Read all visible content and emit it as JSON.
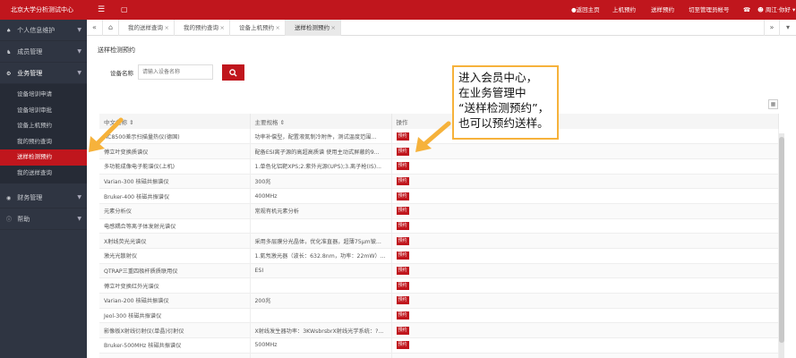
{
  "app": {
    "title": "北京大学分析测试中心"
  },
  "sidebar": {
    "items": [
      {
        "label": "个人信息维护",
        "icon": "person-icon"
      },
      {
        "label": "成员管理",
        "icon": "group-icon"
      },
      {
        "label": "业务管理",
        "icon": "gear-icon",
        "children": [
          {
            "label": "设备培训申请"
          },
          {
            "label": "设备培训审批"
          },
          {
            "label": "设备上机预约"
          },
          {
            "label": "我的预约查询"
          },
          {
            "label": "送样检测预约",
            "active": true
          },
          {
            "label": "我的送样查询"
          }
        ]
      },
      {
        "label": "财务管理",
        "icon": "money-icon"
      },
      {
        "label": "帮助",
        "icon": "help-icon"
      }
    ]
  },
  "topbar": {
    "toggle_icon": "menu-icon",
    "nav": [
      {
        "label": "●返回主页"
      },
      {
        "label": "上机预约"
      },
      {
        "label": "送样预约"
      },
      {
        "label": "切至管理员帐号"
      },
      {
        "label": "周江·你好 ▾"
      }
    ]
  },
  "tabs": [
    {
      "label": "我的送样查询"
    },
    {
      "label": "我的预约查询"
    },
    {
      "label": "设备上机预约"
    },
    {
      "label": "送样检测预约",
      "active": true
    }
  ],
  "page": {
    "title": "送样检测预约",
    "search_label": "设备名称",
    "search_placeholder": "请输入设备名称"
  },
  "table": {
    "columns": [
      "中文名称 ⇕",
      "主要规格 ⇕",
      "操作"
    ],
    "action_label": "预约",
    "rows": [
      [
        "AC8500差示扫描量热仪(德国)",
        "功率补偿型，配置液氮制冷附件，测试温度范围..."
      ],
      [
        "傅立叶变换质谱仪",
        "配备ESI离子源的高超高质谱 使用主动式屏蔽的9..."
      ],
      [
        "多功能成像电子能谱仪(上机)",
        "1.单色化铝靶XPS;2.紫外光源(UPS);3.离子枪(IS)..."
      ],
      [
        "Varian-300 核磁共振谱仪",
        "300兆"
      ],
      [
        "Bruker-400 核磁共振谱仪",
        "400MHz"
      ],
      [
        "元素分析仪",
        "常规有机元素分析"
      ],
      [
        "电感耦合等离子体发射光谱仪",
        ""
      ],
      [
        "X射线荧光光谱仪",
        "采用多层膜分光晶体，优化准直器，超薄75μm铍..."
      ],
      [
        "激光光散射仪",
        "1.氦氖激光器（波长：632.8nm，功率：22mW）..."
      ],
      [
        "QTRAP三重四极杆质质联用仪",
        "ESI"
      ],
      [
        "傅立叶变换红外光谱仪",
        ""
      ],
      [
        "Varian-200 核磁共振谱仪",
        "200兆"
      ],
      [
        "Jeol-300 核磁共振谱仪",
        ""
      ],
      [
        "影像板X射线衍射仪(单晶)衍射仪",
        "X射线发生器功率：3KWsbrsbrX射线光学系统：?..."
      ],
      [
        "Bruker-500MHz 核磁共振谱仪",
        "500MHz"
      ],
      [
        "",
        ""
      ]
    ]
  },
  "annotation": {
    "lines": [
      "进入会员中心，",
      "在业务管理中",
      "“送样检测预约”，",
      "也可以预约送样。"
    ],
    "color": "#f6b23b"
  },
  "colors": {
    "brand": "#c0161d",
    "sidebar": "#2f3542",
    "accent": "#f6b23b"
  }
}
